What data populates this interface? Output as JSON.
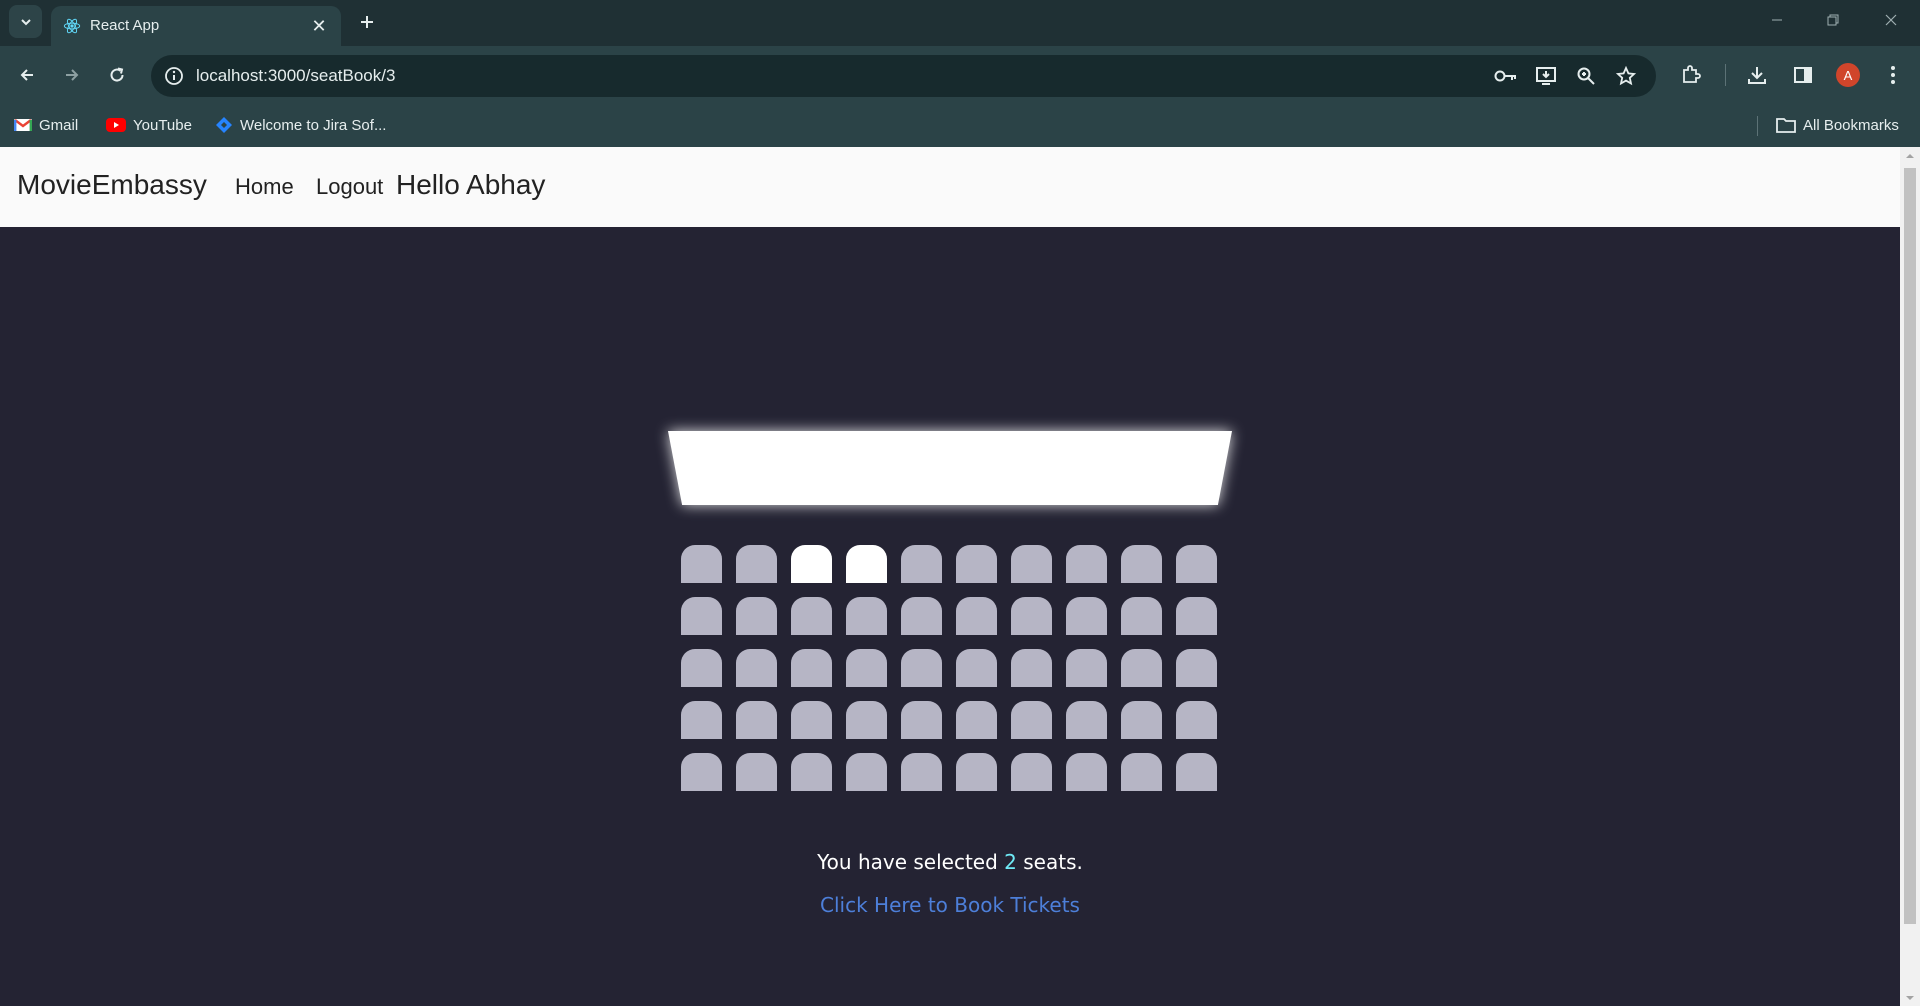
{
  "browser": {
    "tab": {
      "title": "React App"
    },
    "url": "localhost:3000/seatBook/3",
    "bookmarks": [
      {
        "label": "Gmail"
      },
      {
        "label": "YouTube"
      },
      {
        "label": "Welcome to Jira Sof..."
      }
    ],
    "all_bookmarks_label": "All Bookmarks",
    "profile_initial": "A",
    "colors": {
      "chrome_dark": "#1f3034",
      "chrome": "#2b4347",
      "omnibox": "#172a2d"
    }
  },
  "navbar": {
    "brand": "MovieEmbassy",
    "links": [
      {
        "label": "Home"
      },
      {
        "label": "Logout"
      }
    ],
    "greeting": "Hello Abhay"
  },
  "theater": {
    "rows": 5,
    "seats_per_row": 10,
    "selected_seats": [
      [
        0,
        2
      ],
      [
        0,
        3
      ]
    ],
    "colors": {
      "background": "#242333",
      "seat": "#b6b5c5",
      "seat_selected": "#ffffff",
      "screen": "#ffffff",
      "count": "#6feaf6",
      "link": "#4d7fd9"
    }
  },
  "summary": {
    "prefix": "You have selected",
    "count": "2",
    "suffix": "seats."
  },
  "book_link": "Click Here to Book Tickets"
}
